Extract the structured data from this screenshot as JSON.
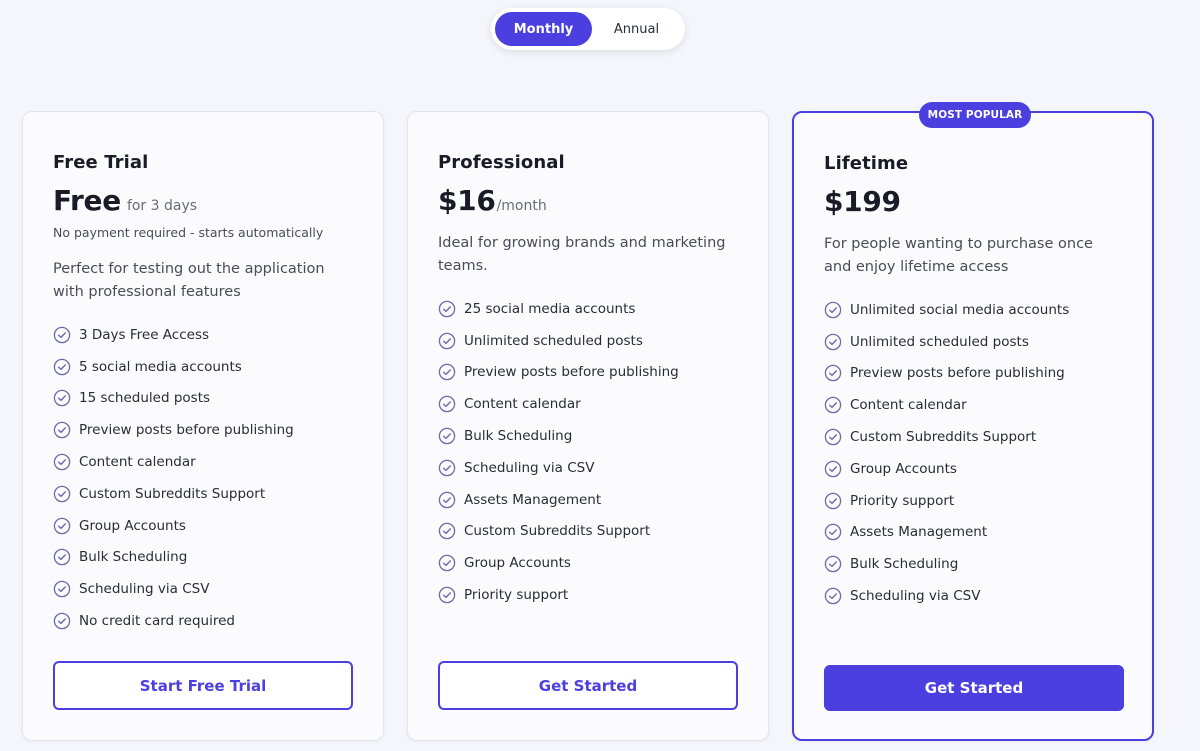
{
  "billing_toggle": {
    "monthly": "Monthly",
    "annual": "Annual"
  },
  "plans": [
    {
      "name": "Free Trial",
      "price": "Free",
      "price_suffix": "for 3 days",
      "note": "No payment required - starts automatically",
      "description": "Perfect for testing out the application with professional features",
      "features": [
        "3 Days Free Access",
        "5 social media accounts",
        "15 scheduled posts",
        "Preview posts before publishing",
        "Content calendar",
        "Custom Subreddits Support",
        "Group Accounts",
        "Bulk Scheduling",
        "Scheduling via CSV",
        "No credit card required"
      ],
      "button": "Start Free Trial"
    },
    {
      "name": "Professional",
      "price": "$16",
      "price_suffix": "/month",
      "description": "Ideal for growing brands and marketing teams.",
      "features": [
        "25 social media accounts",
        "Unlimited scheduled posts",
        "Preview posts before publishing",
        "Content calendar",
        "Bulk Scheduling",
        "Scheduling via CSV",
        "Assets Management",
        "Custom Subreddits Support",
        "Group Accounts",
        "Priority support"
      ],
      "button": "Get Started"
    },
    {
      "name": "Lifetime",
      "badge": "MOST POPULAR",
      "price": "$199",
      "description": "For people wanting to purchase once and enjoy lifetime access",
      "features": [
        "Unlimited social media accounts",
        "Unlimited scheduled posts",
        "Preview posts before publishing",
        "Content calendar",
        "Custom Subreddits Support",
        "Group Accounts",
        "Priority support",
        "Assets Management",
        "Bulk Scheduling",
        "Scheduling via CSV"
      ],
      "button": "Get Started"
    }
  ],
  "colors": {
    "accent": "#4b3fe0",
    "background": "#f5f6fb",
    "card": "#fbfbfe"
  },
  "icons": {
    "feature_check": "check-circle-icon"
  }
}
